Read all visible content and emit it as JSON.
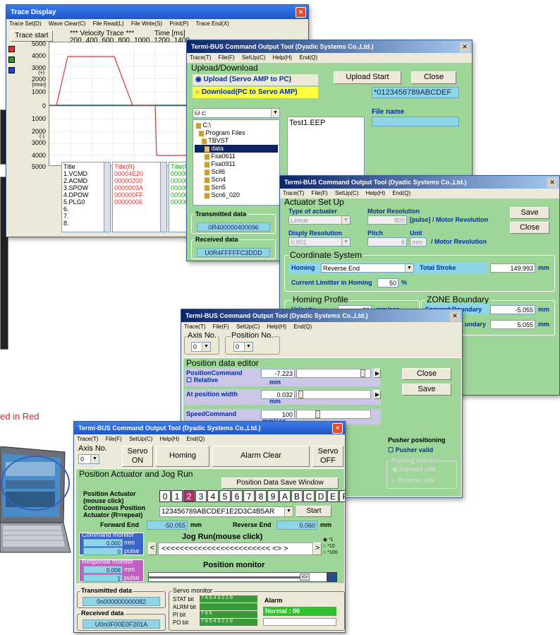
{
  "trace": {
    "title": "Trace Display",
    "menu": [
      "Trace Set(D)",
      "Wave Clear(C)",
      "File Read(L)",
      "File Write(S)",
      "Print(P)",
      "Trace End(X)"
    ],
    "start_button": "Trace start",
    "velocity_label": "*** Velocity Trace ***",
    "time_label": "Time [ms]",
    "time_ticks": [
      "200",
      "400",
      "600",
      "800",
      "1000",
      "1200",
      "1400"
    ],
    "y_ticks": [
      "5000",
      "4000",
      "3000",
      "2000",
      "1000",
      "0",
      "1000",
      "2000",
      "3000",
      "4000",
      "5000"
    ],
    "y_unit_top": "(+)",
    "y_unit_mid": "[r/min]",
    "y_unit_bot": "(-)",
    "list_header": "Title",
    "list_items": [
      "1.VCMD",
      "2.ACMD",
      "3.SPOW",
      "4.DPOW",
      "5.PLG0",
      "6.",
      "7.",
      "8."
    ],
    "red_header": "Title(R)",
    "red_values": [
      "00004E20",
      "00000200",
      "0000003A",
      "000000FF",
      "00000006"
    ],
    "green_header": "Title(G)",
    "green_values": [
      "00000",
      "00000",
      "00000",
      "00000",
      "00000"
    ],
    "colors": {
      "red": "#e03030",
      "green": "#20a020",
      "blue": "#2040e0"
    }
  },
  "upload": {
    "title": "Termi-BUS Command Output Tool (Dyadic Systems Co.,Ltd.)",
    "menu": [
      "Trace(T)",
      "File(F)",
      "SetUp(C)",
      "Help(H)",
      "End(Q)"
    ],
    "heading": "Upload/Download",
    "opt_upload": "Upload  (Servo AMP to PC)",
    "opt_download": "Download(PC to Servo AMP)",
    "upload_start": "Upload  Start",
    "close": "Close",
    "serial": "*0123456789ABCDEF",
    "drive": "c:",
    "folders": [
      "C:\\",
      "Program Files",
      "TBVST",
      "data",
      "Fsa0611",
      "Fsa0911",
      "Scll6",
      "Scn4",
      "Scn5",
      "Scn6_020"
    ],
    "file": "Test1.EEP",
    "file_name_label": "File name",
    "tx_label": "Transmitted data",
    "tx_value": "0R400000400096",
    "rx_label": "Received data",
    "rx_value": "U0R4FFFFFC3DDD"
  },
  "actuator": {
    "title": "Termi-BUS Command Output Tool (Dyadic Systems Co.,Ltd.)",
    "menu": [
      "Trace(T)",
      "File(F)",
      "SetUp(C)",
      "Help(H)",
      "End(Q)"
    ],
    "heading": "Actuator Set Up",
    "type_label": "Type of actuater",
    "type_value": "Linear",
    "motor_res_label": "Motor Resolution",
    "motor_res_value": "800",
    "motor_res_unit": "[pulse] / Motor Revolution",
    "disp_res_label": "Disply Resolution",
    "disp_res_value": "0.001",
    "pitch_label": "Pitch",
    "pitch_value": "6",
    "unit_label": "Unit",
    "unit_value": "mm",
    "unit_suffix": "/ Motor Revolution",
    "save": "Save",
    "close": "Close",
    "coord_heading": "Coordinate System",
    "homing_label": "Homing",
    "homing_value": "Reverse End",
    "stroke_label": "Total Stroke",
    "stroke_value": "149.993",
    "stroke_unit": "mm",
    "limiter_label": "Current Limitter in Homing",
    "limiter_value": "50",
    "limiter_unit": "%",
    "homing_profile": "Homing Profile",
    "velocity_label": "Velocity",
    "velocity_value": "20",
    "velocity_unit": "mm/sec",
    "zone_heading": "ZONE Boundary",
    "fwd_label": "Forward Boundary",
    "fwd_value": "-5.055",
    "rev_label": "undary",
    "rev_value": "5.055",
    "mm": "mm"
  },
  "posdata": {
    "title": "Termi-BUS Command Output Tool (Dyadic Systems Co.,Ltd.)",
    "menu": [
      "Trace(T)",
      "File(F)",
      "SetUp(C)",
      "Help(H)",
      "End(Q)"
    ],
    "axis_label": "Axis No.",
    "axis_value": "0",
    "pos_label": "Position No.",
    "pos_value": "0",
    "heading": "Position data editor",
    "poscmd_label": "PositionCommand",
    "poscmd_value": "-7.223",
    "relative_label": "Relative",
    "mm": "mm",
    "atpos_label": "At position width",
    "atpos_value": "0.032",
    "speed_label": "SpeedCommand",
    "speed_value": "100",
    "speed_unit": "mm/sec",
    "close": "Close",
    "save": "Save",
    "pusher_heading": "Pusher positioning",
    "pusher_valid": "Pusher valid",
    "pushing_dir": "Pushing direction",
    "fwd_side": "Forward side",
    "rev_side": "Reverse side"
  },
  "jog": {
    "title": "Termi-BUS Command Output Tool (Dyadic Systems Co.,Ltd.)",
    "menu": [
      "Trace(T)",
      "File(F)",
      "SetUp(C)",
      "Help(H)",
      "End(Q)"
    ],
    "axis_label": "Axis No.",
    "axis_value": "0",
    "servo_on": "Servo\nON",
    "homing": "Homing",
    "alarm_clear": "Alarm Clear",
    "servo_off": "Servo\nOFF",
    "heading": "Position Actuator and Jog Run",
    "save_window": "Position Data Save Window",
    "pos_act_label": "Position Actuator\n(mouse click)",
    "hex_keys": [
      "0",
      "1",
      "2",
      "3",
      "4",
      "5",
      "6",
      "7",
      "8",
      "9",
      "A",
      "B",
      "C",
      "D",
      "E",
      "F"
    ],
    "cont_label": "Continuous Position\nActuator (R=repeat)",
    "cont_value": "123456789ABCDEF1E2D3C4B5AR",
    "start": "Start",
    "fwd_end_label": "Forward End",
    "fwd_end_value": "-50.055",
    "rev_end_label": "Reverse End",
    "rev_end_value": "0.060",
    "mm": "mm",
    "cmd_monitor": "Command monitor",
    "cmd_mm": "0.000",
    "cmd_pulse": "0",
    "jog_label": "Jog Run(mouse click)",
    "jog_arrows": "<<<<<<<<<<<<<<<<<<<<<<<< <> >",
    "lt": "<",
    "gt": ">",
    "mult": [
      "*1",
      "*10",
      "*100"
    ],
    "resp_monitor": "Response monitor",
    "resp_mm": "0.008",
    "resp_pulse": "1",
    "pos_monitor": "Position monitor",
    "pulse": "pulse",
    "tx_label": "Transmitted data",
    "tx_value": "0n000000000082",
    "rx_label": "Received data",
    "rx_value": "U0n0F00E0F201A",
    "servo_monitor": "Servo monitor",
    "stat": "STAT bit",
    "alrm": "ALRM bit",
    "pi": "PI  bit",
    "po": "PO  bit",
    "stat_bits": "7 6 5 4 3 2 1 0",
    "pi_bits": "7 6 5",
    "alarm_label": "Alarm",
    "alarm_value": "Normal : 00"
  },
  "red_caption": "ed in Red"
}
